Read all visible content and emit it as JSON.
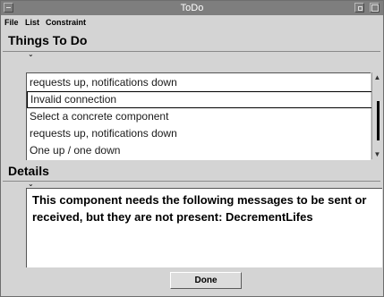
{
  "window": {
    "title": "ToDo"
  },
  "menubar": {
    "items": [
      "File",
      "List",
      "Constraint"
    ]
  },
  "todo_pane": {
    "title": "Things To Do",
    "items": [
      {
        "label": "requests up, notifications down",
        "selected": false
      },
      {
        "label": "Invalid connection",
        "selected": true
      },
      {
        "label": "Select a concrete component",
        "selected": false
      },
      {
        "label": "requests up, notifications down",
        "selected": false
      },
      {
        "label": "One up / one down",
        "selected": false
      }
    ]
  },
  "details_pane": {
    "title": "Details",
    "text": "This component needs the following messages to be sent or received, but they are not present: DecrementLifes"
  },
  "buttons": {
    "done_label": "Done"
  },
  "icons": {
    "list_expand": "caret-down-icon",
    "details_expand": "caret-down-icon",
    "scroll_up": "arrow-up-icon",
    "scroll_down": "arrow-down-icon"
  },
  "colors": {
    "titlebar": "#7e7e7e",
    "window_bg": "#d4d4d4",
    "list_bg": "#ffffff"
  }
}
